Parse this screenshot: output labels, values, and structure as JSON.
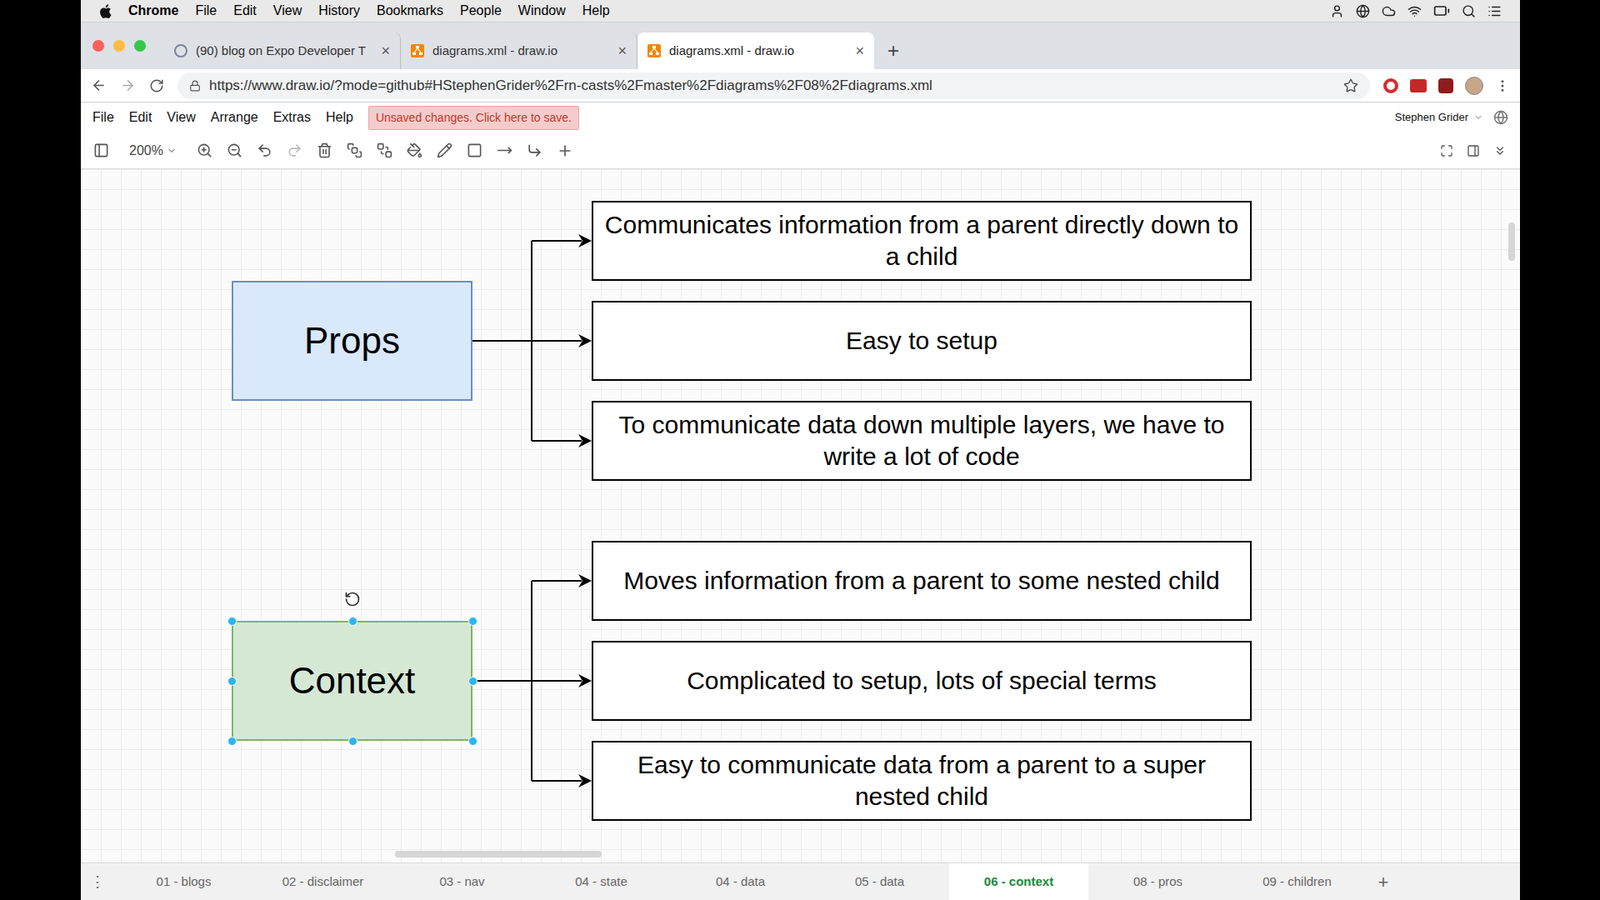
{
  "menubar": {
    "app": "Chrome",
    "items": [
      "File",
      "Edit",
      "View",
      "History",
      "Bookmarks",
      "People",
      "Window",
      "Help"
    ]
  },
  "browser_tabs": [
    {
      "title": "(90) blog on Expo Developer T",
      "selected": false
    },
    {
      "title": "diagrams.xml - draw.io",
      "selected": false
    },
    {
      "title": "diagrams.xml - draw.io",
      "selected": true
    }
  ],
  "tab_close": "×",
  "new_tab": "+",
  "address": "https://www.draw.io/?mode=github#HStephenGrider%2Frn-casts%2Fmaster%2Fdiagrams%2F08%2Fdiagrams.xml",
  "app_menu": [
    "File",
    "Edit",
    "View",
    "Arrange",
    "Extras",
    "Help"
  ],
  "save_notice": "Unsaved changes. Click here to save.",
  "user": "Stephen Grider",
  "zoom": "200%",
  "groups": [
    {
      "node": {
        "label": "Props",
        "selected": false,
        "color": "#dae8fc",
        "border": "#6c8ebf"
      },
      "items": [
        "Communicates information from a parent directly down to a child",
        "Easy to setup",
        "To communicate data down multiple layers, we have to write a lot of code"
      ]
    },
    {
      "node": {
        "label": "Context",
        "selected": true,
        "color": "#d5e8d4",
        "border": "#82b366"
      },
      "items": [
        "Moves information from a parent to some nested child",
        "Complicated to setup, lots of special terms",
        "Easy to communicate data from a parent to a super nested child"
      ]
    }
  ],
  "pages": [
    {
      "label": "01 - blogs",
      "selected": false
    },
    {
      "label": "02 - disclaimer",
      "selected": false
    },
    {
      "label": "03 - nav",
      "selected": false
    },
    {
      "label": "04 - state",
      "selected": false
    },
    {
      "label": "04 - data",
      "selected": false
    },
    {
      "label": "05 - data",
      "selected": false
    },
    {
      "label": "06 - context",
      "selected": true
    },
    {
      "label": "08 - pros",
      "selected": false
    },
    {
      "label": "09 - children",
      "selected": false
    }
  ],
  "page_menu": "⋮",
  "add_page": "+"
}
